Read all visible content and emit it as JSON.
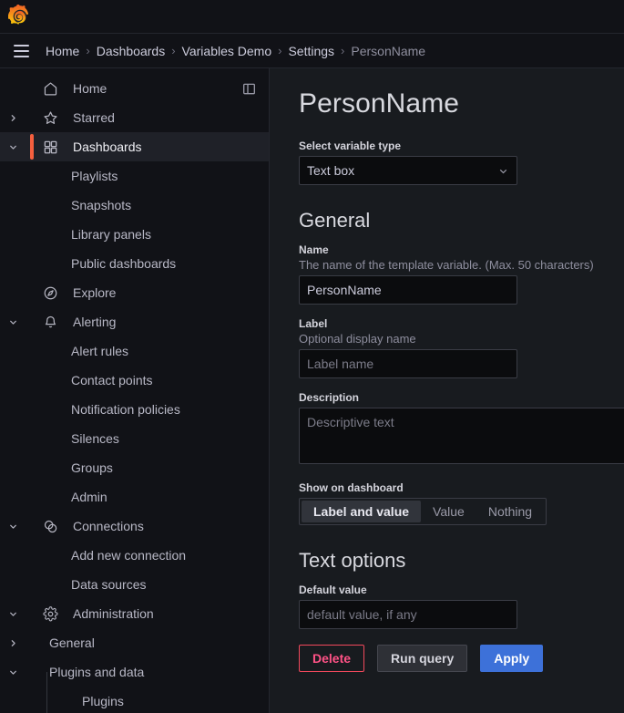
{
  "app": {
    "logo_name": "grafana-logo",
    "accent_orange": "#f55f3e",
    "accent_blue": "#3d71d9",
    "danger_red": "#f2495c"
  },
  "breadcrumb": {
    "menu_label": "Open menu",
    "separator": "›",
    "items": [
      {
        "label": "Home",
        "current": false
      },
      {
        "label": "Dashboards",
        "current": false
      },
      {
        "label": "Variables Demo",
        "current": false
      },
      {
        "label": "Settings",
        "current": false
      },
      {
        "label": "PersonName",
        "current": true
      }
    ]
  },
  "sidebar": {
    "dock_label": "Dock menu",
    "items": [
      {
        "label": "Home",
        "icon": "home-icon",
        "level": 0,
        "chevron": "none",
        "active": false
      },
      {
        "label": "Starred",
        "icon": "star-icon",
        "level": 0,
        "chevron": "right",
        "active": false
      },
      {
        "label": "Dashboards",
        "icon": "dashboards-icon",
        "level": 0,
        "chevron": "down",
        "active": true
      },
      {
        "label": "Playlists",
        "icon": "none",
        "level": 1,
        "chevron": "none",
        "active": false
      },
      {
        "label": "Snapshots",
        "icon": "none",
        "level": 1,
        "chevron": "none",
        "active": false
      },
      {
        "label": "Library panels",
        "icon": "none",
        "level": 1,
        "chevron": "none",
        "active": false
      },
      {
        "label": "Public dashboards",
        "icon": "none",
        "level": 1,
        "chevron": "none",
        "active": false
      },
      {
        "label": "Explore",
        "icon": "compass-icon",
        "level": 0,
        "chevron": "none",
        "active": false
      },
      {
        "label": "Alerting",
        "icon": "bell-icon",
        "level": 0,
        "chevron": "down",
        "active": false
      },
      {
        "label": "Alert rules",
        "icon": "none",
        "level": 1,
        "chevron": "none",
        "active": false
      },
      {
        "label": "Contact points",
        "icon": "none",
        "level": 1,
        "chevron": "none",
        "active": false
      },
      {
        "label": "Notification policies",
        "icon": "none",
        "level": 1,
        "chevron": "none",
        "active": false
      },
      {
        "label": "Silences",
        "icon": "none",
        "level": 1,
        "chevron": "none",
        "active": false
      },
      {
        "label": "Groups",
        "icon": "none",
        "level": 1,
        "chevron": "none",
        "active": false
      },
      {
        "label": "Admin",
        "icon": "none",
        "level": 1,
        "chevron": "none",
        "active": false
      },
      {
        "label": "Connections",
        "icon": "connections-icon",
        "level": 0,
        "chevron": "down",
        "active": false
      },
      {
        "label": "Add new connection",
        "icon": "none",
        "level": 1,
        "chevron": "none",
        "active": false
      },
      {
        "label": "Data sources",
        "icon": "none",
        "level": 1,
        "chevron": "none",
        "active": false
      },
      {
        "label": "Administration",
        "icon": "gear-icon",
        "level": 0,
        "chevron": "down",
        "active": false
      },
      {
        "label": "General",
        "icon": "none",
        "level": 1,
        "chevron": "right",
        "active": false
      },
      {
        "label": "Plugins and data",
        "icon": "none",
        "level": 1,
        "chevron": "down",
        "active": false
      },
      {
        "label": "Plugins",
        "icon": "none",
        "level": 2,
        "chevron": "none",
        "active": false
      }
    ]
  },
  "main": {
    "page_title": "PersonName",
    "variable_type": {
      "label": "Select variable type",
      "value": "Text box"
    },
    "general": {
      "heading": "General",
      "name": {
        "label": "Name",
        "description": "The name of the template variable. (Max. 50 characters)",
        "value": "PersonName"
      },
      "label_field": {
        "label": "Label",
        "description": "Optional display name",
        "value": "",
        "placeholder": "Label name"
      },
      "description_field": {
        "label": "Description",
        "value": "",
        "placeholder": "Descriptive text"
      },
      "show_on_dashboard": {
        "label": "Show on dashboard",
        "options": [
          "Label and value",
          "Value",
          "Nothing"
        ],
        "selected": "Label and value"
      }
    },
    "text_options": {
      "heading": "Text options",
      "default_value": {
        "label": "Default value",
        "value": "",
        "placeholder": "default value, if any"
      }
    },
    "actions": {
      "delete": "Delete",
      "run_query": "Run query",
      "apply": "Apply"
    }
  }
}
